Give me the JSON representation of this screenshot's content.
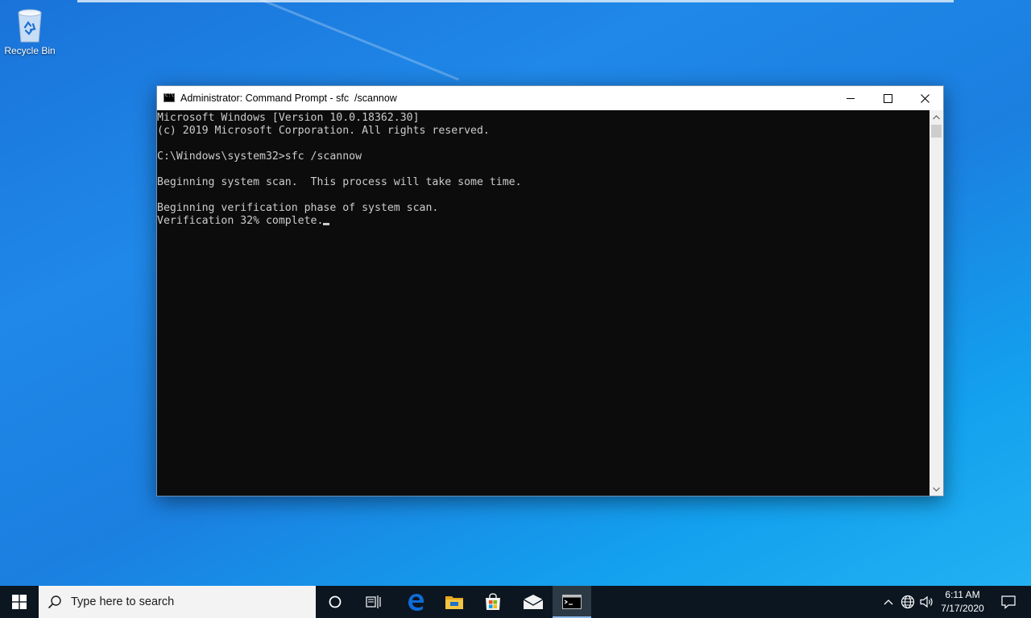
{
  "desktop": {
    "icons": [
      {
        "label": "Recycle Bin"
      }
    ]
  },
  "window": {
    "title": "Administrator: Command Prompt - sfc  /scannow",
    "console_lines": [
      "Microsoft Windows [Version 10.0.18362.30]",
      "(c) 2019 Microsoft Corporation. All rights reserved.",
      "",
      "C:\\Windows\\system32>sfc /scannow",
      "",
      "Beginning system scan.  This process will take some time.",
      "",
      "Beginning verification phase of system scan.",
      "Verification 32% complete."
    ],
    "background_color": "#0c0c0c",
    "text_color": "#cccccc"
  },
  "taskbar": {
    "search_placeholder": "Type here to search",
    "pinned": [
      "cortana-icon",
      "task-view-icon",
      "edge-icon",
      "file-explorer-icon",
      "store-icon",
      "mail-icon",
      "command-prompt-icon"
    ],
    "active": "command-prompt-icon",
    "clock": {
      "time": "6:11 AM",
      "date": "7/17/2020"
    }
  },
  "colors": {
    "desktop_accent": "#1b7fe0",
    "taskbar": "#0b1621",
    "edge_blue": "#0f6cd8",
    "explorer_yellow": "#f4c542"
  }
}
